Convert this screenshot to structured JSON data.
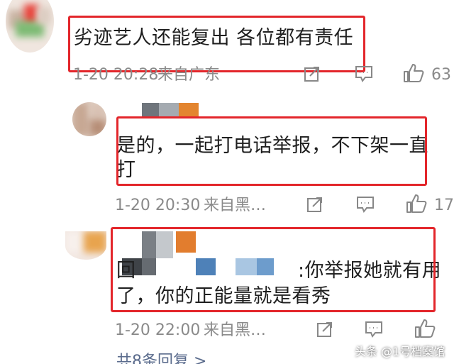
{
  "comments": [
    {
      "text": "劣迹艺人还能复出 各位都有责任",
      "time": "1-20 20:28",
      "location": "来自广东",
      "like_count": "63"
    },
    {
      "text_line1": "是的，一起打电话举报，不下架一直",
      "text_line2": "打",
      "time": "1-20 20:30",
      "location": "来自黑…",
      "like_count": "17"
    },
    {
      "reply_prefix": "回",
      "text_line1": ":你举报她就有用",
      "text_line2": "了，你的正能量就是看秀",
      "time": "1-20 22:00",
      "location": "来自黑…"
    }
  ],
  "footer": {
    "reply_count": "共8条回复 >"
  },
  "watermark": "头条 @1号档案馆",
  "colors": {
    "highlight_box": "#e3262b",
    "meta_text": "#8a8a8a",
    "body_text": "#1f1f1f"
  },
  "icons": [
    "share-icon",
    "comment-icon",
    "like-icon"
  ]
}
